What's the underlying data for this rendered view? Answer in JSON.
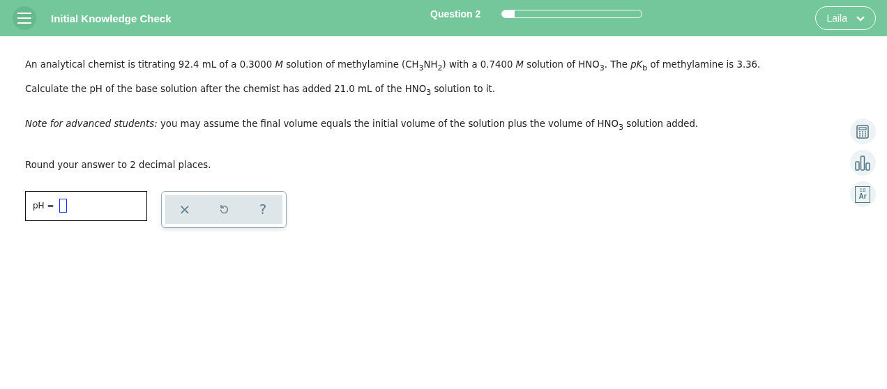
{
  "header": {
    "title": "Initial Knowledge Check",
    "question": "Question 2",
    "progress": {
      "level": 0.09
    },
    "user": "Laila"
  },
  "question": {
    "paragraphs": [
      "An analytical chemist is titrating 92.4 mL of a 0.3000 *M* solution of methylamine (CH$_{3}$NH$_{2}$) with a 0.7400 *M* solution of HNO$_{3}$. The *pK*$_{b}$ of methylamine is 3.36. Calculate the pH of the base solution after the chemist has added 21.0 mL of the HNO$_{3}$ solution to it.",
      "*Note for advanced students:* you may assume the final volume equals the initial volume of the solution plus the volume of HNO$_{3}$ solution added.",
      "Round your answer to 2 decimal places."
    ]
  },
  "answer": {
    "label": "pH ="
  },
  "actions": [
    {
      "kind": "clear",
      "label": "×"
    },
    {
      "kind": "undo"
    },
    {
      "kind": "help",
      "label": "?"
    }
  ],
  "tools": [
    {
      "kind": "calculator"
    },
    {
      "kind": "chart"
    },
    {
      "kind": "element",
      "number": "18",
      "symbol": "Ar"
    }
  ]
}
